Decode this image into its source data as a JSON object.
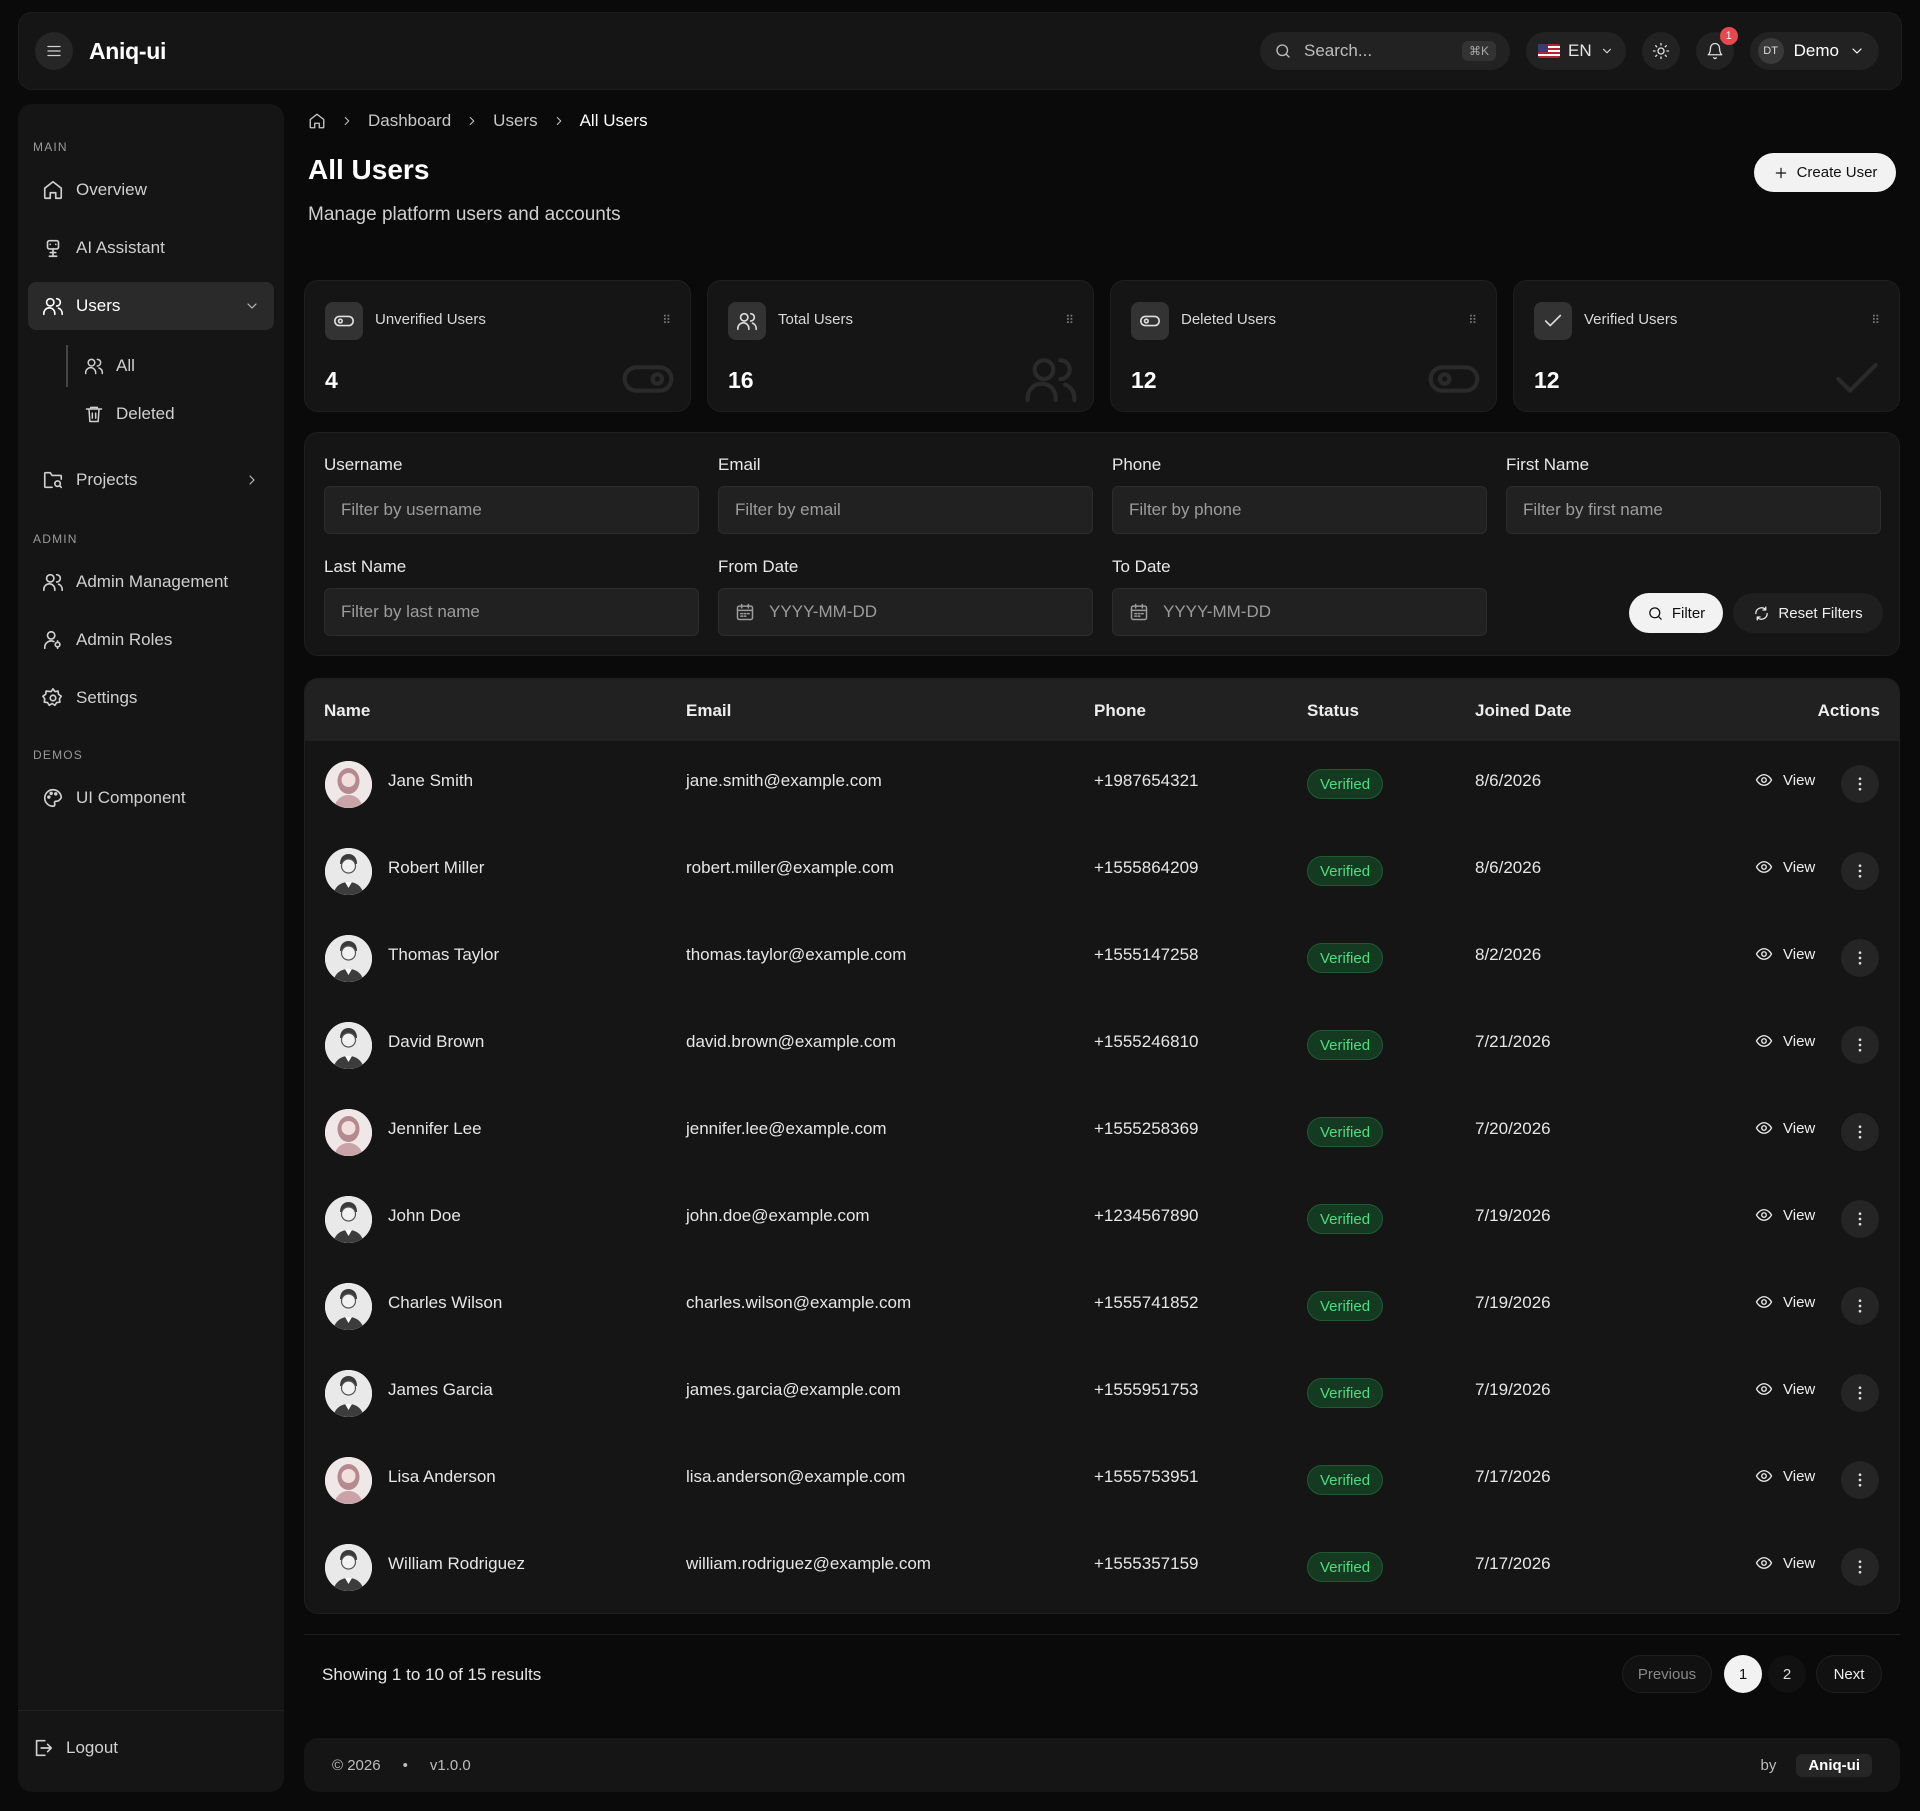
{
  "app": {
    "brand": "Aniq-ui"
  },
  "topbar": {
    "search_placeholder": "Search...",
    "search_shortcut": "⌘K",
    "language": "EN",
    "notification_count": "1",
    "user_initials": "DT",
    "user_name": "Demo"
  },
  "sidebar": {
    "sections": {
      "main": "MAIN",
      "admin": "ADMIN",
      "demos": "DEMOS"
    },
    "items": {
      "overview": "Overview",
      "ai_assistant": "AI Assistant",
      "users": "Users",
      "users_all": "All",
      "users_deleted": "Deleted",
      "projects": "Projects",
      "admin_management": "Admin Management",
      "admin_roles": "Admin Roles",
      "settings": "Settings",
      "ui_component": "UI Component"
    },
    "logout": "Logout"
  },
  "breadcrumb": [
    "Dashboard",
    "Users",
    "All Users"
  ],
  "page": {
    "title": "All Users",
    "subtitle": "Manage platform users and accounts",
    "create_button": "Create User"
  },
  "stats": [
    {
      "label": "Unverified Users",
      "value": "4"
    },
    {
      "label": "Total Users",
      "value": "16"
    },
    {
      "label": "Deleted Users",
      "value": "12"
    },
    {
      "label": "Verified Users",
      "value": "12"
    }
  ],
  "filters": {
    "username": {
      "label": "Username",
      "placeholder": "Filter by username"
    },
    "email": {
      "label": "Email",
      "placeholder": "Filter by email"
    },
    "phone": {
      "label": "Phone",
      "placeholder": "Filter by phone"
    },
    "first_name": {
      "label": "First Name",
      "placeholder": "Filter by first name"
    },
    "last_name": {
      "label": "Last Name",
      "placeholder": "Filter by last name"
    },
    "from_date": {
      "label": "From Date",
      "placeholder": "YYYY-MM-DD"
    },
    "to_date": {
      "label": "To Date",
      "placeholder": "YYYY-MM-DD"
    },
    "filter_button": "Filter",
    "reset_button": "Reset Filters"
  },
  "table": {
    "headers": {
      "name": "Name",
      "email": "Email",
      "phone": "Phone",
      "status": "Status",
      "joined": "Joined Date",
      "actions": "Actions"
    },
    "view_label": "View",
    "rows": [
      {
        "name": "Jane Smith",
        "email": "jane.smith@example.com",
        "phone": "+1987654321",
        "status": "Verified",
        "joined": "8/6/2026",
        "gender": "female"
      },
      {
        "name": "Robert Miller",
        "email": "robert.miller@example.com",
        "phone": "+1555864209",
        "status": "Verified",
        "joined": "8/6/2026",
        "gender": "male"
      },
      {
        "name": "Thomas Taylor",
        "email": "thomas.taylor@example.com",
        "phone": "+1555147258",
        "status": "Verified",
        "joined": "8/2/2026",
        "gender": "male"
      },
      {
        "name": "David Brown",
        "email": "david.brown@example.com",
        "phone": "+1555246810",
        "status": "Verified",
        "joined": "7/21/2026",
        "gender": "male"
      },
      {
        "name": "Jennifer Lee",
        "email": "jennifer.lee@example.com",
        "phone": "+1555258369",
        "status": "Verified",
        "joined": "7/20/2026",
        "gender": "female"
      },
      {
        "name": "John Doe",
        "email": "john.doe@example.com",
        "phone": "+1234567890",
        "status": "Verified",
        "joined": "7/19/2026",
        "gender": "male"
      },
      {
        "name": "Charles Wilson",
        "email": "charles.wilson@example.com",
        "phone": "+1555741852",
        "status": "Verified",
        "joined": "7/19/2026",
        "gender": "male"
      },
      {
        "name": "James Garcia",
        "email": "james.garcia@example.com",
        "phone": "+1555951753",
        "status": "Verified",
        "joined": "7/19/2026",
        "gender": "male"
      },
      {
        "name": "Lisa Anderson",
        "email": "lisa.anderson@example.com",
        "phone": "+1555753951",
        "status": "Verified",
        "joined": "7/17/2026",
        "gender": "female"
      },
      {
        "name": "William Rodriguez",
        "email": "william.rodriguez@example.com",
        "phone": "+1555357159",
        "status": "Verified",
        "joined": "7/17/2026",
        "gender": "male"
      }
    ]
  },
  "pagination": {
    "summary": "Showing 1 to 10 of 15 results",
    "previous": "Previous",
    "pages": [
      "1",
      "2"
    ],
    "next": "Next"
  },
  "footer": {
    "copyright": "© 2026",
    "version": "v1.0.0",
    "by": "by",
    "brand": "Aniq-ui"
  },
  "colors": {
    "accent": "#f2f2f2",
    "verified": "#4ade80",
    "notification": "#e5484d"
  }
}
